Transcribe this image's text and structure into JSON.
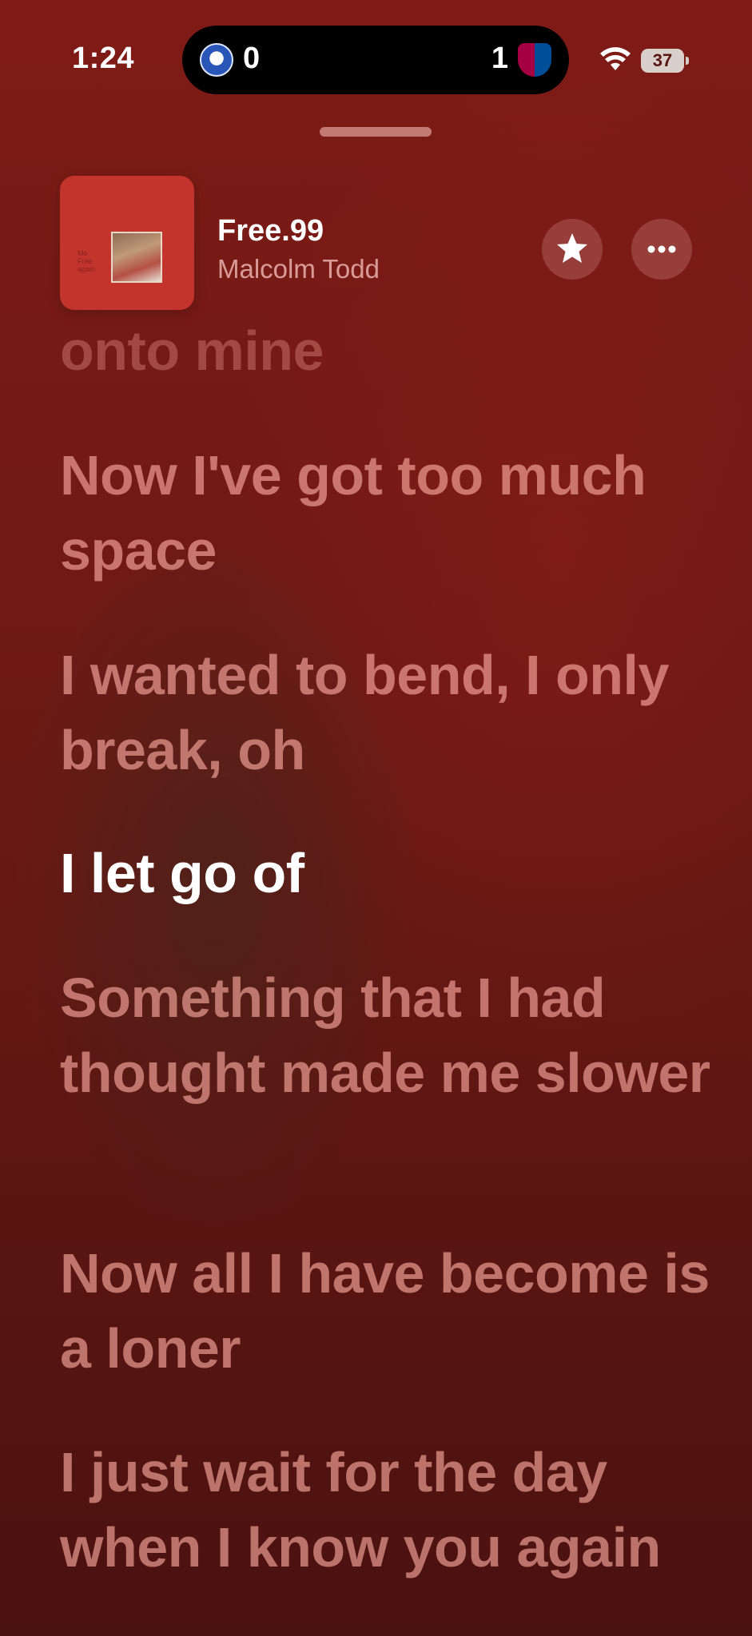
{
  "status_bar": {
    "time": "1:24",
    "score_home": "0",
    "score_away": "1",
    "battery": "37"
  },
  "now_playing": {
    "title": "Free.99",
    "artist": "Malcolm Todd",
    "artwork_text": "Me\nFree\nagain"
  },
  "lyrics": [
    "onto mine",
    "Now I've got too much space",
    "I wanted to bend, I only break, oh",
    "I let go of",
    "Something that I had thought made me slower",
    "Now all I have become is a loner",
    "I just wait for the day when I know you again"
  ],
  "active_lyric_index": 3,
  "colors": {
    "background": "#741a15",
    "inactive_lyric": "#ffafa5",
    "active_lyric": "#ffffff"
  }
}
